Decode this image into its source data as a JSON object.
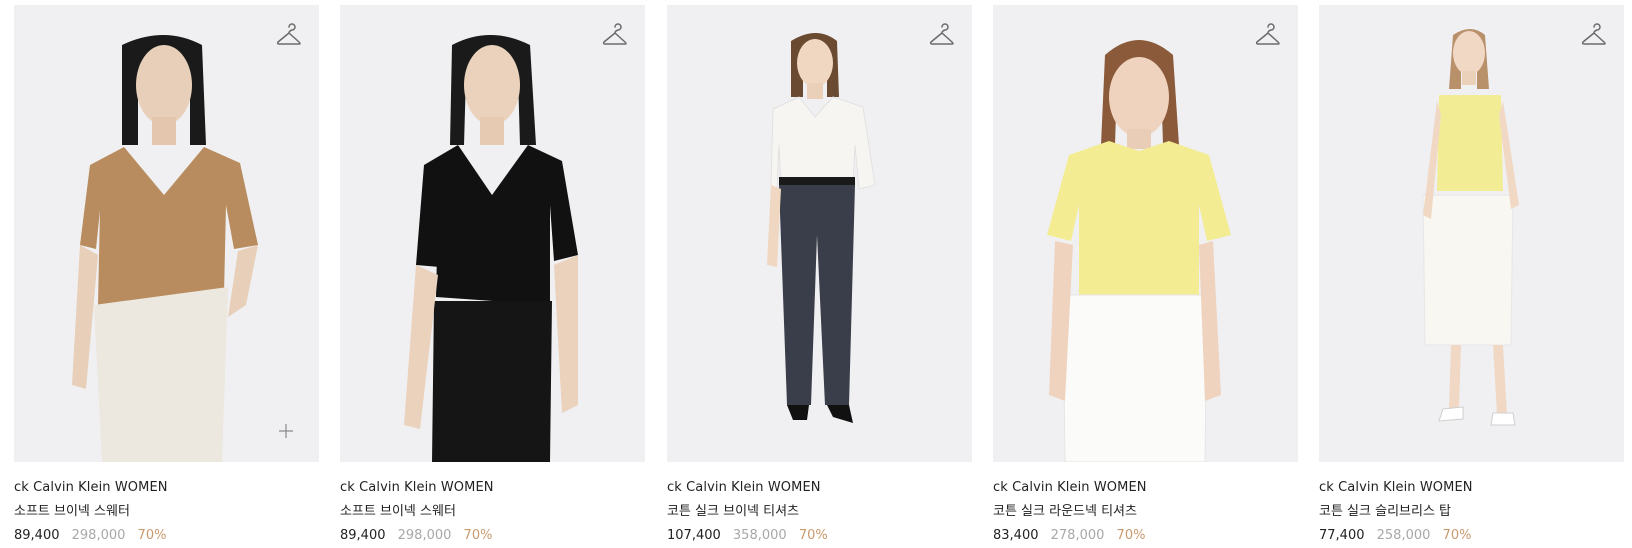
{
  "colors": {
    "image_bg": "#f0f0f2",
    "text": "#222222",
    "original_price": "#a8a8a8",
    "discount": "#c99a6e"
  },
  "products": [
    {
      "brand": "ck Calvin Klein WOMEN",
      "name": "소프트 브이넥 스웨터",
      "price": "89,400",
      "original_price": "298,000",
      "discount": "70%",
      "top_color": "#b88c5e",
      "bottom_color": "#ece8e0",
      "icons": [
        "hanger-icon",
        "plus-icon"
      ]
    },
    {
      "brand": "ck Calvin Klein WOMEN",
      "name": "소프트 브이넥 스웨터",
      "price": "89,400",
      "original_price": "298,000",
      "discount": "70%",
      "top_color": "#111111",
      "bottom_color": "#151515",
      "icons": [
        "hanger-icon"
      ]
    },
    {
      "brand": "ck Calvin Klein WOMEN",
      "name": "코튼 실크 브이넥 티셔츠",
      "price": "107,400",
      "original_price": "358,000",
      "discount": "70%",
      "top_color": "#f6f5f1",
      "bottom_color": "#3a3d4a",
      "icons": [
        "hanger-icon"
      ]
    },
    {
      "brand": "ck Calvin Klein WOMEN",
      "name": "코튼 실크 라운드넥 티셔츠",
      "price": "83,400",
      "original_price": "278,000",
      "discount": "70%",
      "top_color": "#f3ec93",
      "bottom_color": "#fbfbf9",
      "icons": [
        "hanger-icon"
      ]
    },
    {
      "brand": "ck Calvin Klein WOMEN",
      "name": "코튼 실크 슬리브리스 탑",
      "price": "77,400",
      "original_price": "258,000",
      "discount": "70%",
      "top_color": "#f2ec95",
      "bottom_color": "#f8f7f2",
      "icons": [
        "hanger-icon"
      ]
    }
  ]
}
